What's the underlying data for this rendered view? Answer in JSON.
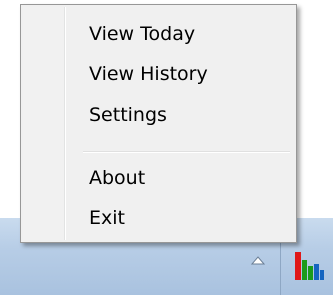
{
  "context_menu": {
    "items": [
      {
        "label": "View Today"
      },
      {
        "label": "View History"
      },
      {
        "label": "Settings"
      },
      {
        "label": "About"
      },
      {
        "label": "Exit"
      }
    ]
  },
  "taskbar": {
    "tray_arrow_icon": "triangle-up-icon",
    "app_icon": "bar-chart-icon",
    "app_icon_colors": [
      "#e01818",
      "#1b9b1b",
      "#1565c0"
    ]
  },
  "colors": {
    "menu_background": "#f0f0f0",
    "menu_border": "#979797",
    "taskbar_top": "#c9dbee",
    "taskbar_bottom": "#a9c2df"
  }
}
